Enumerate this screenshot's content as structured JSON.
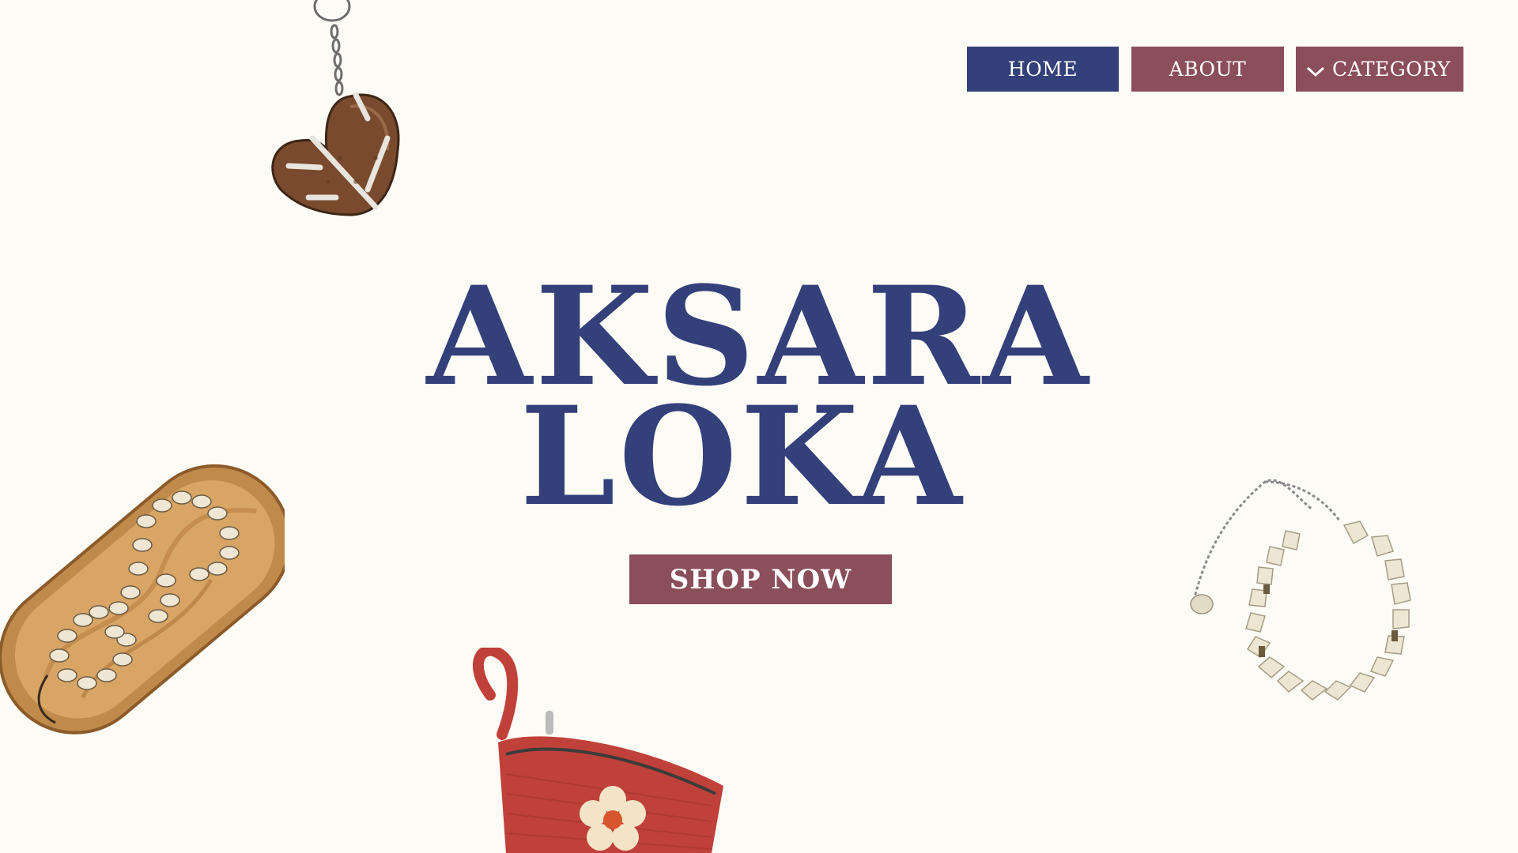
{
  "nav": {
    "home_label": "HOME",
    "about_label": "ABOUT",
    "category_label": "CATEGORY"
  },
  "hero": {
    "title_line1": "AKSARA",
    "title_line2": "LOKA",
    "cta_label": "SHOP NOW"
  },
  "colors": {
    "background": "#fdfbf5",
    "primary_blue": "#33407a",
    "accent_mauve": "#8b4e5b"
  },
  "icons": {
    "category_dropdown": "chevron-down-icon"
  }
}
